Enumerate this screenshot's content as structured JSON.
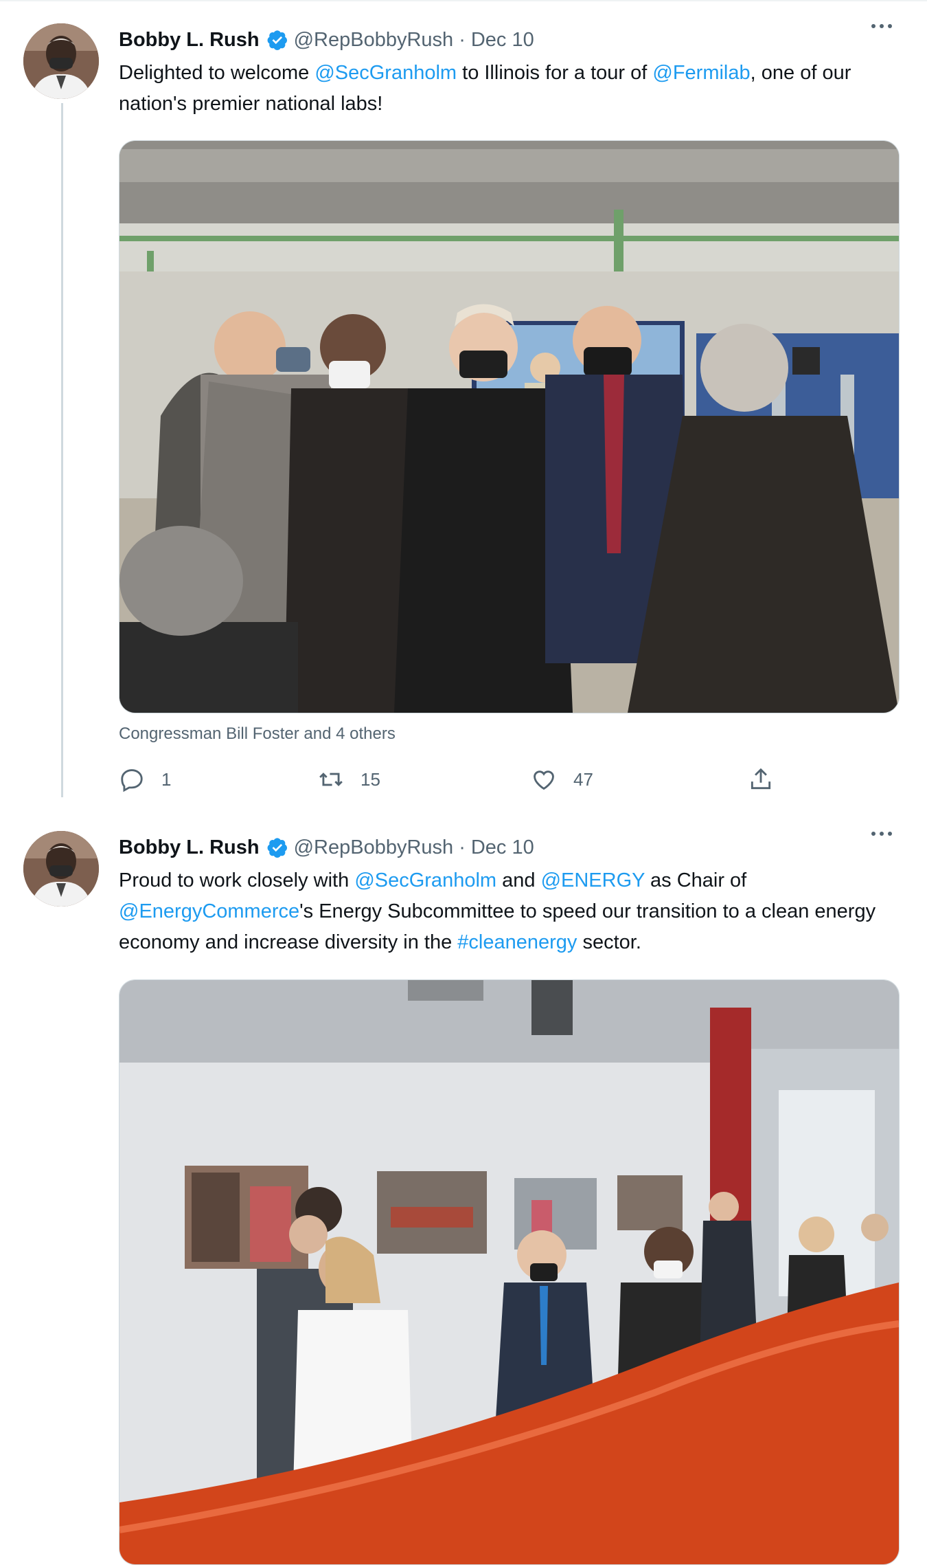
{
  "tweets": [
    {
      "author_name": "Bobby L. Rush",
      "handle": "@RepBobbyRush",
      "separator": "·",
      "date": "Dec 10",
      "text_parts": [
        "Delighted to welcome ",
        "@SecGranholm",
        " to Illinois for a tour of ",
        "@Fermilab",
        ", one of our nation's premier national labs!"
      ],
      "caption": "Congressman Bill Foster and 4 others",
      "reply_count": "1",
      "retweet_count": "15",
      "like_count": "47"
    },
    {
      "author_name": "Bobby L. Rush",
      "handle": "@RepBobbyRush",
      "separator": "·",
      "date": "Dec 10",
      "text_parts": [
        "Proud to work closely with ",
        "@SecGranholm",
        " and ",
        "@ENERGY",
        " as Chair of ",
        "@EnergyCommerce",
        "'s Energy Subcommittee to speed our transition to a clean energy economy and increase diversity in the ",
        "#cleanenergy",
        " sector."
      ]
    }
  ],
  "icons": {
    "verified": "verified-badge-icon",
    "more": "more-options-icon",
    "reply": "reply-icon",
    "retweet": "retweet-icon",
    "like": "like-icon",
    "share": "share-icon"
  },
  "colors": {
    "link": "#1d9bf0",
    "secondary_text": "#536471",
    "verified": "#1d9bf0"
  }
}
